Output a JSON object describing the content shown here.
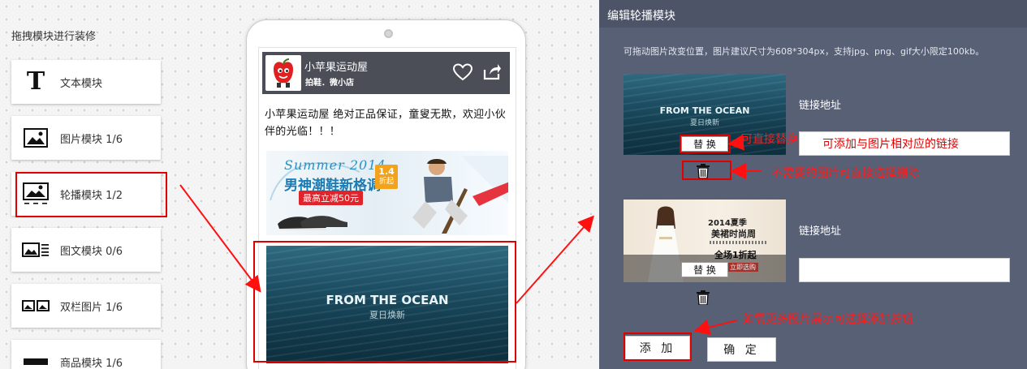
{
  "palette": {
    "title": "拖拽模块进行装修",
    "modules": [
      {
        "label": "文本模块",
        "icon": "text-icon"
      },
      {
        "label": "图片模块 1/6",
        "icon": "image-icon"
      },
      {
        "label": "轮播模块 1/2",
        "icon": "carousel-icon"
      },
      {
        "label": "图文模块 0/6",
        "icon": "image-text-icon"
      },
      {
        "label": "双栏图片 1/6",
        "icon": "double-image-icon"
      },
      {
        "label": "商品模块 1/6",
        "icon": "product-icon"
      }
    ]
  },
  "preview": {
    "shop_name": "小苹果运动屋",
    "shop_subtitle": "拍鞋．微小店",
    "intro": "小苹果运动屋 绝对正品保证，童叟无欺，欢迎小伙伴的光临！！！",
    "banner1": {
      "brand_top": "Summer 2014",
      "headline": "男神潮鞋新格调",
      "promo": "最高立减50元",
      "badge_top": "1.4",
      "badge_bottom": "折起"
    },
    "banner2": {
      "title": "FROM THE OCEAN",
      "subtitle": "夏日焕新"
    }
  },
  "panel": {
    "title": "编辑轮播模块",
    "hint": "可拖动图片改变位置，图片建议尺寸为608*304px，支持jpg、png、gif大小限定100kb。",
    "slides": [
      {
        "image_title": "FROM THE OCEAN",
        "image_subtitle": "夏日焕新",
        "replace_label": "替 换",
        "link_label": "链接地址",
        "link_value": "可添加与图片相对应的链接"
      },
      {
        "image_line1": "2014夏季",
        "image_line2": "美裙时尚周",
        "image_line3": "全场1折起",
        "image_line4": "立即选购",
        "replace_label": "替 换",
        "link_label": "链接地址",
        "link_value": ""
      }
    ],
    "add_label": "添 加",
    "confirm_label": "确 定"
  },
  "annotations": {
    "replace_note": "可直接替换",
    "delete_note": "不需要的图片可直接选择删除",
    "add_note": "如需更多图片展示可选择添加按钮"
  },
  "colors": {
    "highlight": "#e00000",
    "panel": "#586075",
    "shop_header": "#4b4e57"
  }
}
